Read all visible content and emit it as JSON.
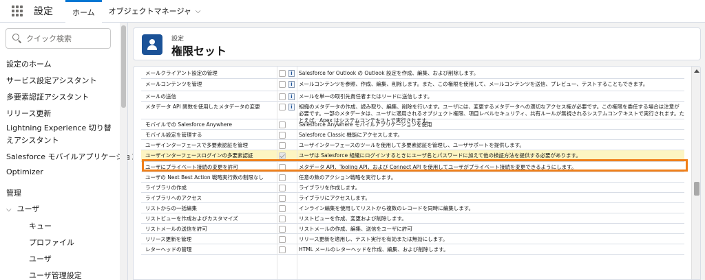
{
  "topbar": {
    "app_name": "設定",
    "tabs": [
      {
        "label": "ホーム"
      },
      {
        "label": "オブジェクトマネージャ"
      }
    ]
  },
  "sidebar": {
    "search_placeholder": "クイック検索",
    "items": [
      {
        "label": "設定のホーム"
      },
      {
        "label": "サービス設定アシスタント"
      },
      {
        "label": "多要素認証アシスタント"
      },
      {
        "label": "リリース更新"
      },
      {
        "label": "Lightning Experience 切り替えアシスタント"
      },
      {
        "label": "Salesforce モバイルアプリケーション"
      },
      {
        "label": "Optimizer"
      },
      {
        "label": "管理"
      },
      {
        "label": "ユーザ"
      }
    ],
    "sub_items": [
      {
        "label": "キュー"
      },
      {
        "label": "プロファイル"
      },
      {
        "label": "ユーザ"
      },
      {
        "label": "ユーザ管理設定"
      }
    ]
  },
  "header": {
    "breadcrumb": "設定",
    "title": "権限セット"
  },
  "permissions": [
    {
      "name": "メールクライアント設定の管理",
      "checked": false,
      "desc": "Salesforce for Outlook の Outlook 設定を作成、編集、および削除します。"
    },
    {
      "name": "メールコンテンツを管理",
      "checked": false,
      "desc": "メールコンテンツを参照、作成、編集、削除します。また、この権限を使用して、メールコンテンツを送信、プレビュー、テストすることもできます。"
    },
    {
      "name": "メールの送信",
      "checked": false,
      "desc": "メールを単一の取引先責任者またはリードに送信します。"
    },
    {
      "name": "メタデータ API 関数を使用したメタデータの変更",
      "checked": false,
      "desc": "組織のメタデータの作成、読み取り、編集、削除を行います。ユーザには、変更するメタデータへの適切なアクセス権が必要です。この権限を委任する場合は注意が必要です。一部のメタデータは、ユーザに適用されるオブジェクト権限、項目レベルセキュリティ、共有ルールが無視されるシステムコンテキストで実行されます。たとえば、Apex はシステムコンテキストで実行されます。"
    },
    {
      "name": "モバイルでの Salesforce Anywhere",
      "checked": false,
      "desc": "Salesforce Anywhere モバイルアプリケーションを使用"
    },
    {
      "name": "モバイル設定を管理する",
      "checked": false,
      "desc": "Salesforce Classic 機能にアクセスします。"
    },
    {
      "name": "ユーザインターフェースで多要素認証を管理",
      "checked": false,
      "desc": "ユーザインターフェースのツールを使用して多要素認証を管理し、ユーザサポートを提供します。"
    },
    {
      "name": "ユーザインターフェースログインの多要素認証",
      "checked": true,
      "desc": "ユーザは Salesforce 組織にログインするときにユーザ名とパスワードに加えて他の検証方法を提供する必要があります。"
    },
    {
      "name": "ユーザにプライベート接続の変更を許可",
      "checked": false,
      "desc": "メタデータ API、Tooling API、および Connect API を使用してユーザがプライベート接続を変更できるようにします。"
    },
    {
      "name": "ユーザの Next Best Action 戦略実行数の制限なし",
      "checked": false,
      "desc": "任意の数のアクション戦略を実行します。"
    },
    {
      "name": "ライブラリの作成",
      "checked": false,
      "desc": "ライブラリを作成します。"
    },
    {
      "name": "ライブラリへのアクセス",
      "checked": false,
      "desc": "ライブラリにアクセスします。"
    },
    {
      "name": "リストからの一括編集",
      "checked": false,
      "desc": "インライン編集を使用してリストから複数のレコードを同時に編集します。"
    },
    {
      "name": "リストビューを作成およびカスタマイズ",
      "checked": false,
      "desc": "リストビューを作成、変更および削除します。"
    },
    {
      "name": "リストメールの送信を許可",
      "checked": false,
      "desc": "リストメールの作成、編集、送信をユーザに許可"
    },
    {
      "name": "リリース更新を管理",
      "checked": false,
      "desc": "リリース更新を適用し、テスト実行を有効または無効にします。"
    },
    {
      "name": "レターヘッドの管理",
      "checked": false,
      "desc": "HTML メールのレターヘッドを作成、編集、および削除します。"
    }
  ],
  "colors": {
    "highlight_box": "#f07f19",
    "highlight_row": "#fdf5c2",
    "header_icon": "#1b5297",
    "active_tab": "#0176d3"
  }
}
